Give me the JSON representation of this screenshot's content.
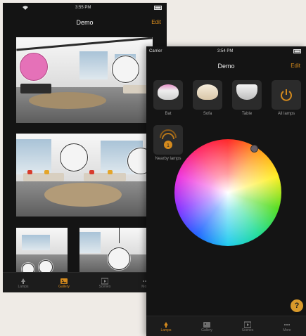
{
  "back_screen": {
    "status": {
      "carrier": "",
      "time": "3:55 PM"
    },
    "nav": {
      "title": "Demo",
      "edit_label": "Edit"
    },
    "tabbar": {
      "tabs": [
        {
          "label": "Lamps",
          "icon": "lamp-icon",
          "active": false
        },
        {
          "label": "Gallery",
          "icon": "gallery-icon",
          "active": true
        },
        {
          "label": "Scenes",
          "icon": "scenes-icon",
          "active": false
        },
        {
          "label": "More",
          "icon": "more-icon",
          "active": false
        }
      ]
    }
  },
  "front_screen": {
    "status": {
      "carrier": "Carrier",
      "time": "3:54 PM"
    },
    "nav": {
      "title": "Demo",
      "edit_label": "Edit"
    },
    "lamps": [
      {
        "label": "Bat",
        "color": "#e0a0c8"
      },
      {
        "label": "Sofa",
        "color": "#f2e6d2"
      },
      {
        "label": "Table",
        "color": "#e6e6e6"
      },
      {
        "label": "All lamps",
        "color": "#d48a1d"
      },
      {
        "label": "Nearby lamps",
        "color": "#d48a1d"
      }
    ],
    "help_label": "?",
    "tabbar": {
      "tabs": [
        {
          "label": "Lamps",
          "icon": "lamp-icon",
          "active": true
        },
        {
          "label": "Gallery",
          "icon": "gallery-icon",
          "active": false
        },
        {
          "label": "Scenes",
          "icon": "scenes-icon",
          "active": false
        },
        {
          "label": "More",
          "icon": "more-icon",
          "active": false
        }
      ]
    }
  },
  "colors": {
    "accent": "#d48a1d",
    "lamp_on": "#e571b8"
  }
}
